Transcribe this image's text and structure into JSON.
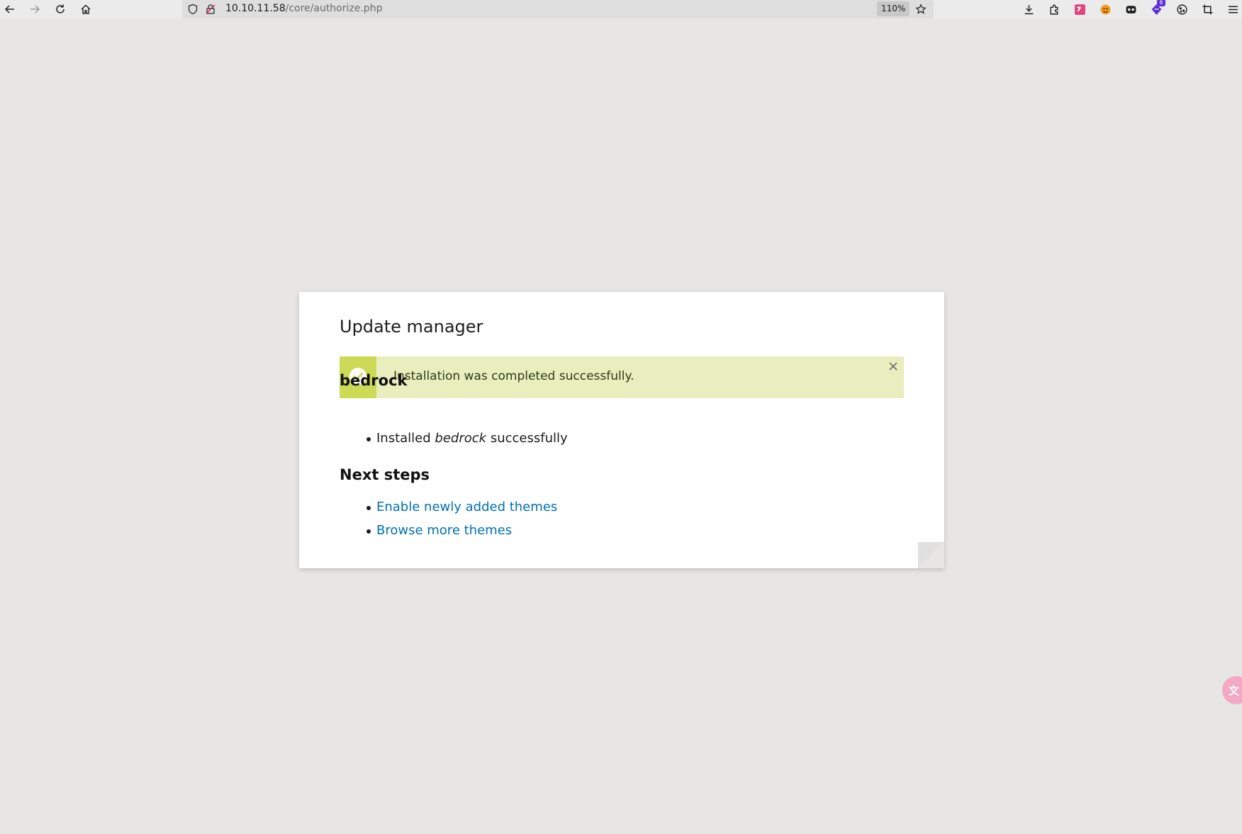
{
  "browser": {
    "url_host": "10.10.11.58",
    "url_path": "/core/authorize.php",
    "zoom": "110%",
    "extension_badge": "6",
    "icons": {
      "back": "back-arrow-icon",
      "forward": "forward-arrow-icon",
      "reload": "reload-icon",
      "home": "home-icon",
      "tracking": "shield-icon",
      "insecure": "insecure-lock-icon",
      "bookmark": "star-icon",
      "downloads": "download-icon",
      "extensions": "puzzle-icon",
      "menu": "hamburger-menu-icon"
    }
  },
  "card": {
    "title": "Update manager",
    "alert": {
      "message": "Installation was completed successfully.",
      "icon": "check-circle-icon",
      "close_icon": "close-icon",
      "color_stripe": "#cdda55",
      "color_background": "#e9eebe"
    },
    "project": {
      "name": "bedrock",
      "items": [
        {
          "prefix": "Installed",
          "name": "bedrock",
          "suffix": "successfully"
        }
      ]
    },
    "next_steps": {
      "title": "Next steps",
      "links": [
        "Enable newly added themes",
        "Browse more themes"
      ],
      "link_color": "#0071b3"
    }
  },
  "side_widget": {
    "glyph": "文"
  }
}
